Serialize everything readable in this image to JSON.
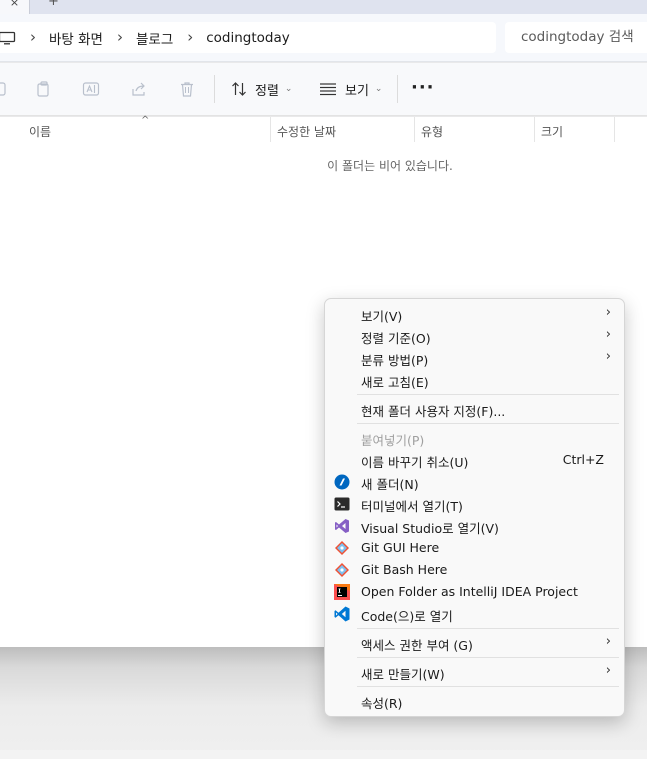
{
  "tab": {
    "close_glyph": "×",
    "new_tab_glyph": "+"
  },
  "address": {
    "crumbs": [
      "바탕 화면",
      "블로그",
      "codingtoday"
    ],
    "separator": "›",
    "search_placeholder": "codingtoday 검색"
  },
  "toolbar": {
    "sort_label": "정렬",
    "view_label": "보기",
    "more_label": "···",
    "chevron": "⌄"
  },
  "columns": {
    "name": "이름",
    "modified": "수정한 날짜",
    "type": "유형",
    "size": "크기",
    "sort_caret": "^"
  },
  "empty_message": "이 폴더는 비어 있습니다.",
  "context_menu": {
    "arrow": "›",
    "items": [
      {
        "label": "보기(V)"
      },
      {
        "label": "정렬 기준(O)"
      },
      {
        "label": "분류 방법(P)"
      },
      {
        "label": "새로 고침(E)"
      },
      {
        "label": "현재 폴더 사용자 지정(F)..."
      },
      {
        "label": "붙여넣기(P)"
      },
      {
        "label": "이름 바꾸기 취소(U)",
        "shortcut": "Ctrl+Z"
      },
      {
        "label": "새 폴더(N)",
        "icon": "new-folder-icon"
      },
      {
        "label": "터미널에서 열기(T)",
        "icon": "terminal-icon"
      },
      {
        "label": "Visual Studio로 열기(V)",
        "icon": "visual-studio-icon"
      },
      {
        "label": "Git GUI Here",
        "icon": "git-gui-icon"
      },
      {
        "label": "Git Bash Here",
        "icon": "git-bash-icon"
      },
      {
        "label": "Open Folder as IntelliJ IDEA Project",
        "icon": "intellij-icon"
      },
      {
        "label": "Code(으)로 열기",
        "icon": "vscode-icon"
      },
      {
        "label": "액세스 권한 부여 (G)"
      },
      {
        "label": "새로 만들기(W)"
      },
      {
        "label": "속성(R)"
      }
    ]
  },
  "colors": {
    "accent_blue": "#0067c0",
    "vs_purple": "#865fc5",
    "git_orange": "#f05133",
    "vscode_blue": "#0078d4"
  }
}
